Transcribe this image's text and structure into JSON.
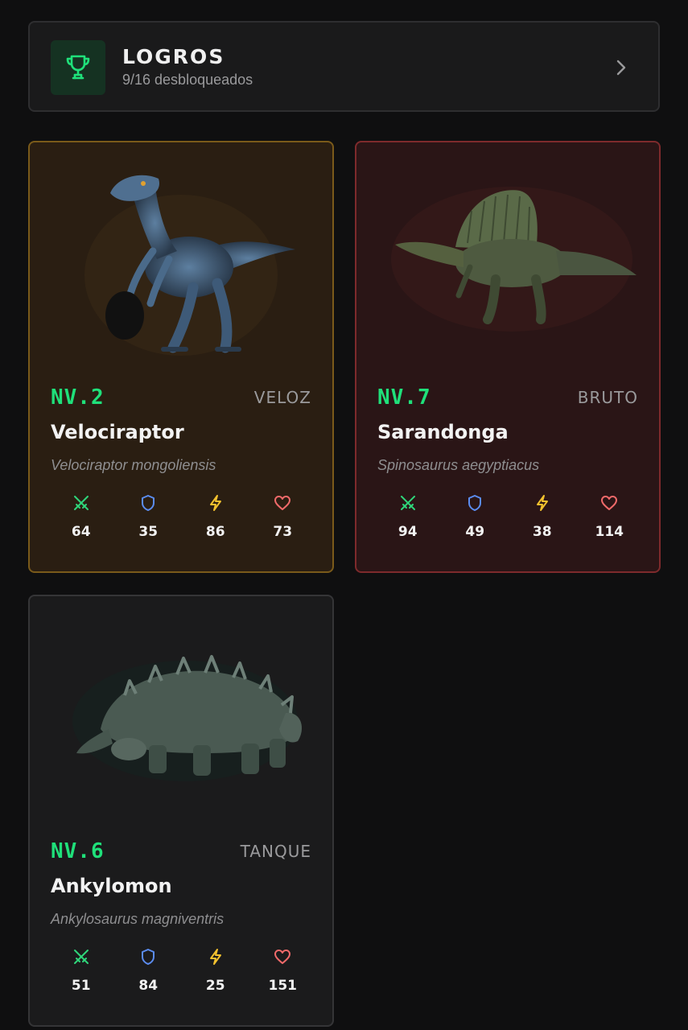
{
  "achievements": {
    "title": "LOGROS",
    "subtitle": "9/16 desbloqueados",
    "icon": "trophy-icon",
    "accent": "#1fe07a"
  },
  "cards": [
    {
      "level": "NV.2",
      "type": "VELOZ",
      "name": "Velociraptor",
      "species": "Velociraptor mongoliensis",
      "art": "velociraptor-illustration",
      "stats": {
        "attack": "64",
        "defense": "35",
        "speed": "86",
        "health": "73"
      }
    },
    {
      "level": "NV.7",
      "type": "BRUTO",
      "name": "Sarandonga",
      "species": "Spinosaurus aegyptiacus",
      "art": "spinosaurus-illustration",
      "stats": {
        "attack": "94",
        "defense": "49",
        "speed": "38",
        "health": "114"
      }
    },
    {
      "level": "NV.6",
      "type": "TANQUE",
      "name": "Ankylomon",
      "species": "Ankylosaurus magniventris",
      "art": "ankylosaurus-illustration",
      "stats": {
        "attack": "51",
        "defense": "84",
        "speed": "25",
        "health": "151"
      }
    }
  ],
  "colors": {
    "level": "#1fe07a",
    "attack": "#2fd57a",
    "defense": "#5b8cf0",
    "speed": "#f2c12e",
    "health": "#f06a6a"
  }
}
